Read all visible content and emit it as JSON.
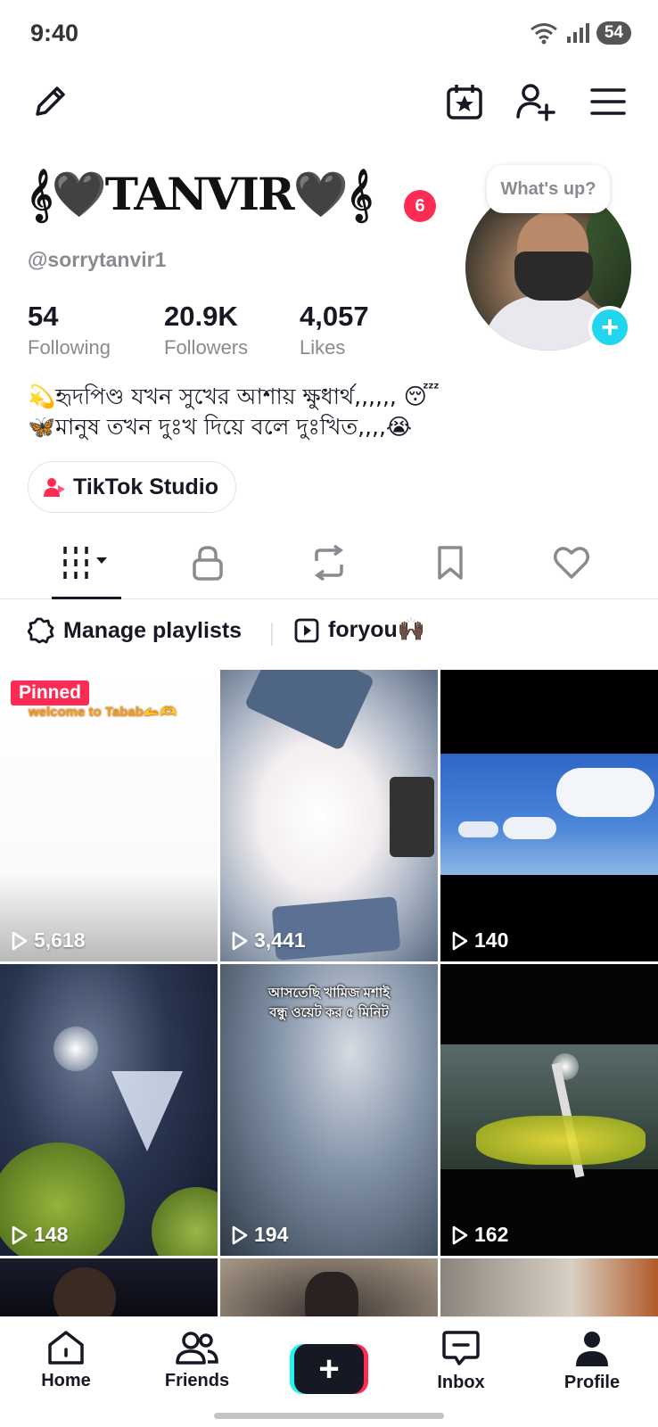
{
  "status_bar": {
    "time": "9:40",
    "battery": "54"
  },
  "profile": {
    "display_name": "𝄞🖤TANVIR🖤𝄞",
    "notification_count": "6",
    "username": "@sorrytanvir1",
    "bubble": "What's up?",
    "stats": [
      {
        "value": "54",
        "label": "Following"
      },
      {
        "value": "20.9K",
        "label": "Followers"
      },
      {
        "value": "4,057",
        "label": "Likes"
      }
    ],
    "bio_lines": [
      "💫হৃদপিণ্ড যখন সুখের আশায় ক্ষুধার্থ,,,,,, 😴",
      "🦋মানুষ তখন দুঃখ দিয়ে  বলে দুঃখিত,,,,😭"
    ],
    "studio_label": "TikTok Studio"
  },
  "playlists": {
    "manage_label": "Manage playlists",
    "playlist_name": "foryou🙌🏿"
  },
  "videos": [
    {
      "views": "5,618",
      "pinned_label": "Pinned",
      "caption": "welcome to Tabab🫴🫶"
    },
    {
      "views": "3,441"
    },
    {
      "views": "140"
    },
    {
      "views": "148"
    },
    {
      "views": "194",
      "caption_lines": [
        "আসতেছি খামিজ মশাই",
        "বন্ধু ওয়েট কর ৫ মিনিট"
      ]
    },
    {
      "views": "162"
    }
  ],
  "bottom_nav": {
    "home": "Home",
    "friends": "Friends",
    "inbox": "Inbox",
    "profile": "Profile"
  },
  "colors": {
    "accent": "#fe2c55",
    "cyan": "#25f4ee",
    "add_button": "#20d5ec",
    "secondary_text": "#8a8b91"
  }
}
